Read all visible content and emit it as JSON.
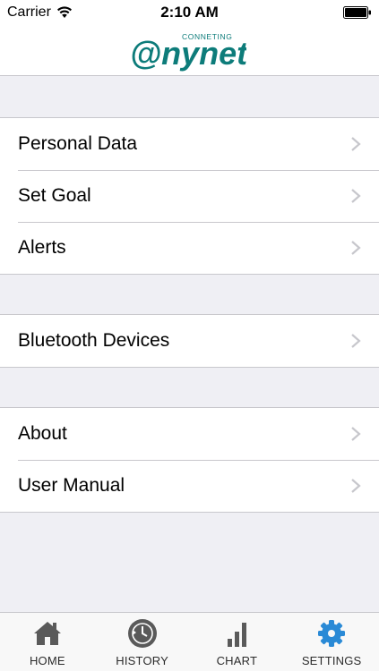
{
  "status_bar": {
    "carrier": "Carrier",
    "time": "2:10 AM"
  },
  "header": {
    "logo_small_text": "CONNETING",
    "logo_main_text": "@nynet",
    "logo_color": "#0d7c7a"
  },
  "groups": [
    {
      "items": [
        {
          "label": "Personal Data"
        },
        {
          "label": "Set Goal"
        },
        {
          "label": "Alerts"
        }
      ]
    },
    {
      "items": [
        {
          "label": "Bluetooth Devices"
        }
      ]
    },
    {
      "items": [
        {
          "label": "About"
        },
        {
          "label": "User Manual"
        }
      ]
    }
  ],
  "tab_bar": {
    "active_color": "#2a8ad6",
    "icon_color": "#5a5a5a",
    "tabs": [
      {
        "label": "HOME",
        "icon": "home-icon"
      },
      {
        "label": "HISTORY",
        "icon": "history-icon"
      },
      {
        "label": "CHART",
        "icon": "bar-chart-icon"
      },
      {
        "label": "SETTINGS",
        "icon": "gear-icon",
        "active": true
      }
    ]
  }
}
